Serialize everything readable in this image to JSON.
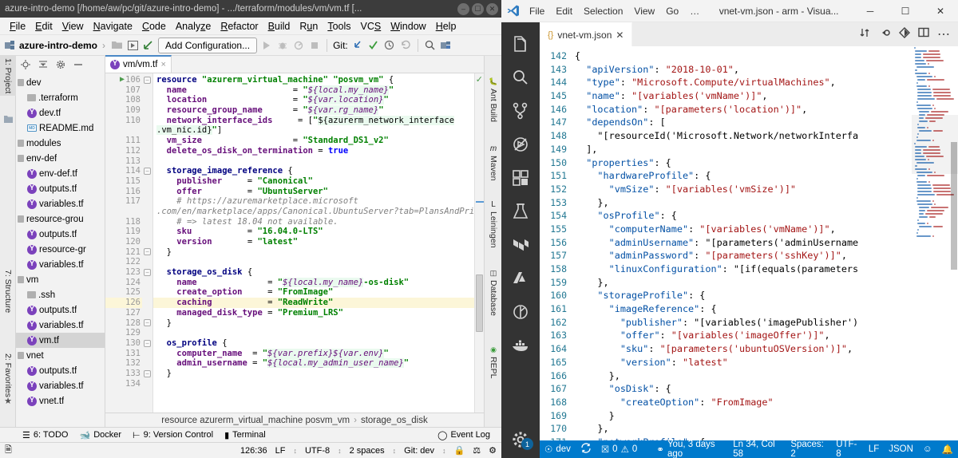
{
  "idea": {
    "title": "azure-intro-demo [/home/aw/pc/git/azure-intro-demo] - .../terraform/modules/vm/vm.tf [...",
    "window_buttons": [
      "minimize",
      "maximize",
      "close"
    ],
    "menus": [
      "File",
      "Edit",
      "View",
      "Navigate",
      "Code",
      "Analyze",
      "Refactor",
      "Build",
      "Run",
      "Tools",
      "VCS",
      "Window",
      "Help"
    ],
    "toolbar": {
      "project_crumb": "azure-intro-demo",
      "run_config": "Add Configuration...",
      "git_label": "Git:",
      "icons": [
        "folder-icon",
        "open-preview-icon",
        "back-arrow-icon",
        "run-icon",
        "debug-icon",
        "coverage-icon",
        "stop-icon",
        "git-update-icon",
        "git-commit-icon",
        "git-history-icon",
        "git-revert-icon",
        "search-everywhere-icon",
        "project-structure-icon"
      ]
    },
    "left_tabs": [
      {
        "label": "1: Project",
        "selected": true
      },
      {
        "label": "7: Structure",
        "selected": false
      },
      {
        "label": "2: Favorites",
        "selected": false
      }
    ],
    "right_tabs": [
      "Ant Build",
      "Maven",
      "Leiningen",
      "Database",
      "REPL"
    ],
    "project_panel": {
      "header_icons": [
        "locate-icon",
        "collapse-all-icon",
        "settings-icon",
        "hide-icon"
      ],
      "tree": [
        {
          "label": "dev",
          "icon": "folder-icon",
          "indent": 1
        },
        {
          "label": ".terraform",
          "icon": "folder-icon",
          "indent": 2
        },
        {
          "label": "dev.tf",
          "icon": "terraform-icon",
          "indent": 2
        },
        {
          "label": "README.md",
          "icon": "markdown-icon",
          "indent": 2
        },
        {
          "label": "modules",
          "icon": "folder-icon",
          "indent": 0
        },
        {
          "label": "env-def",
          "icon": "folder-icon",
          "indent": 1
        },
        {
          "label": "env-def.tf",
          "icon": "terraform-icon",
          "indent": 2
        },
        {
          "label": "outputs.tf",
          "icon": "terraform-icon",
          "indent": 2
        },
        {
          "label": "variables.tf",
          "icon": "terraform-icon",
          "indent": 2
        },
        {
          "label": "resource-grou",
          "icon": "folder-icon",
          "indent": 1
        },
        {
          "label": "outputs.tf",
          "icon": "terraform-icon",
          "indent": 2
        },
        {
          "label": "resource-gr",
          "icon": "terraform-icon",
          "indent": 2
        },
        {
          "label": "variables.tf",
          "icon": "terraform-icon",
          "indent": 2
        },
        {
          "label": "vm",
          "icon": "folder-icon",
          "indent": 1
        },
        {
          "label": ".ssh",
          "icon": "folder-icon",
          "indent": 2
        },
        {
          "label": "outputs.tf",
          "icon": "terraform-icon",
          "indent": 2
        },
        {
          "label": "variables.tf",
          "icon": "terraform-icon",
          "indent": 2
        },
        {
          "label": "vm.tf",
          "icon": "terraform-icon",
          "indent": 2,
          "selected": true
        },
        {
          "label": "vnet",
          "icon": "folder-icon",
          "indent": 1
        },
        {
          "label": "outputs.tf",
          "icon": "terraform-icon",
          "indent": 2
        },
        {
          "label": "variables.tf",
          "icon": "terraform-icon",
          "indent": 2
        },
        {
          "label": "vnet.tf",
          "icon": "terraform-icon",
          "indent": 2
        }
      ]
    },
    "editor_tab": {
      "label": "vm/vm.tf",
      "icon": "terraform-icon",
      "close": "×"
    },
    "code_lines": [
      {
        "n": "106",
        "run": true,
        "fold": "open"
      },
      {
        "n": "107"
      },
      {
        "n": "108"
      },
      {
        "n": "109"
      },
      {
        "n": "110"
      },
      {
        "n": ""
      },
      {
        "n": "111"
      },
      {
        "n": "112"
      },
      {
        "n": "113"
      },
      {
        "n": "114",
        "fold": "open"
      },
      {
        "n": "115"
      },
      {
        "n": "116"
      },
      {
        "n": "117"
      },
      {
        "n": ""
      },
      {
        "n": "118"
      },
      {
        "n": "119"
      },
      {
        "n": "120"
      },
      {
        "n": "121",
        "fold": "close"
      },
      {
        "n": "122"
      },
      {
        "n": "123",
        "fold": "open"
      },
      {
        "n": "124"
      },
      {
        "n": "125"
      },
      {
        "n": "126",
        "highlight": true
      },
      {
        "n": "127"
      },
      {
        "n": "128",
        "fold": "close"
      },
      {
        "n": "129"
      },
      {
        "n": "130",
        "fold": "open"
      },
      {
        "n": "131"
      },
      {
        "n": "132"
      },
      {
        "n": "133",
        "fold": "close"
      },
      {
        "n": "134"
      }
    ],
    "breadcrumb": [
      "resource azurerm_virtual_machine posvm_vm",
      "storage_os_disk"
    ],
    "breadcrumb_sep": "›",
    "tool_buttons": [
      {
        "label": "6: TODO",
        "icon": "todo-icon"
      },
      {
        "label": "Docker",
        "icon": "docker-icon"
      },
      {
        "label": "9: Version Control",
        "icon": "branch-icon"
      },
      {
        "label": "Terminal",
        "icon": "terminal-icon"
      },
      {
        "label": "Event Log",
        "icon": "event-log-icon"
      }
    ],
    "status": {
      "caret": "126:36",
      "line_sep": "LF",
      "encoding": "UTF-8",
      "indent": "2 spaces",
      "branch": "Git: dev",
      "sep": "↕",
      "icons": [
        "lock-icon",
        "inspections-icon",
        "settings-icon",
        "memory-icon"
      ]
    }
  },
  "vscode": {
    "menus": [
      "File",
      "Edit",
      "Selection",
      "View",
      "Go",
      "…"
    ],
    "title": "vnet-vm.json - arm - Visua...",
    "window_buttons": [
      "─",
      "☐",
      "✕"
    ],
    "activity_icons": [
      "explorer-icon",
      "search-icon",
      "source-control-icon",
      "run-debug-icon",
      "extensions-icon",
      "testing-icon",
      "terraform-icon",
      "azure-icon",
      "puppet-icon",
      "docker-icon",
      "settings-gear-icon"
    ],
    "settings_badge": "1",
    "tab": {
      "label": "vnet-vm.json",
      "icon": "json-icon",
      "close": "✕"
    },
    "tab_actions": [
      "split-toggle-icon",
      "hide-icon",
      "diff-icon",
      "split-editor-icon",
      "more-actions-icon"
    ],
    "code": [
      {
        "n": "142",
        "text": "{"
      },
      {
        "n": "143",
        "text": "  \"apiVersion\": \"2018-10-01\","
      },
      {
        "n": "144",
        "text": "  \"type\": \"Microsoft.Compute/virtualMachines\","
      },
      {
        "n": "145",
        "text": "  \"name\": \"[variables('vmName')]\","
      },
      {
        "n": "146",
        "text": "  \"location\": \"[parameters('location')]\","
      },
      {
        "n": "147",
        "text": "  \"dependsOn\": ["
      },
      {
        "n": "148",
        "text": "    \"[resourceId('Microsoft.Network/networkInterfa"
      },
      {
        "n": "149",
        "text": "  ],"
      },
      {
        "n": "150",
        "text": "  \"properties\": {"
      },
      {
        "n": "151",
        "text": "    \"hardwareProfile\": {"
      },
      {
        "n": "152",
        "text": "      \"vmSize\": \"[variables('vmSize')]\""
      },
      {
        "n": "153",
        "text": "    },"
      },
      {
        "n": "154",
        "text": "    \"osProfile\": {"
      },
      {
        "n": "155",
        "text": "      \"computerName\": \"[variables('vmName')]\","
      },
      {
        "n": "156",
        "text": "      \"adminUsername\": \"[parameters('adminUsername"
      },
      {
        "n": "157",
        "text": "      \"adminPassword\": \"[parameters('sshKey')]\","
      },
      {
        "n": "158",
        "text": "      \"linuxConfiguration\": \"[if(equals(parameters"
      },
      {
        "n": "159",
        "text": "    },"
      },
      {
        "n": "160",
        "text": "    \"storageProfile\": {"
      },
      {
        "n": "161",
        "text": "      \"imageReference\": {"
      },
      {
        "n": "162",
        "text": "        \"publisher\": \"[variables('imagePublisher')"
      },
      {
        "n": "163",
        "text": "        \"offer\": \"[variables('imageOffer')]\","
      },
      {
        "n": "164",
        "text": "        \"sku\": \"[parameters('ubuntuOSVersion')]\","
      },
      {
        "n": "165",
        "text": "        \"version\": \"latest\""
      },
      {
        "n": "166",
        "text": "      },"
      },
      {
        "n": "167",
        "text": "      \"osDisk\": {"
      },
      {
        "n": "168",
        "text": "        \"createOption\": \"FromImage\""
      },
      {
        "n": "169",
        "text": "      }"
      },
      {
        "n": "170",
        "text": "    },"
      },
      {
        "n": "171",
        "text": "    \"networkProfile\": {"
      }
    ],
    "status": {
      "branch": "dev",
      "sync_icon": "sync-icon",
      "errors": "0",
      "warnings": "0",
      "blame": "You, 3 days ago",
      "position": "Ln 34, Col 58",
      "spaces": "Spaces: 2",
      "encoding": "UTF-8",
      "eol": "LF",
      "language": "JSON",
      "feedback_icon": "smiley-icon",
      "bell_icon": "bell-icon"
    }
  },
  "colors": {
    "vsc_accent": "#007acc",
    "terraform_purple": "#7b42bc",
    "idea_tab_accent": "#4a88c7",
    "json_key": "#0451a5",
    "json_string": "#a31515"
  }
}
